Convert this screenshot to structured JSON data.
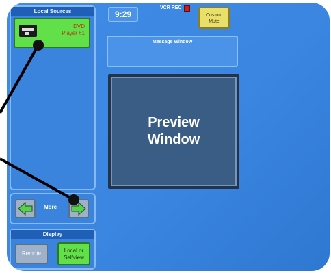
{
  "local_sources": {
    "title": "Local Sources",
    "item_label": "DVD Player #1"
  },
  "header": {
    "time": "9:29",
    "vcr_label": "VCR REC",
    "custom_mute_label": "Custom Mute"
  },
  "message_window": {
    "title": "Message Window"
  },
  "preview": {
    "label": "Preview Window"
  },
  "nav": {
    "more_label": "More"
  },
  "display": {
    "title": "Display",
    "remote_label": "Remote",
    "local_label": "Local or Selfview"
  },
  "colors": {
    "screen": "#3a86e0",
    "green_button": "#62e049",
    "preview": "#3a5d86"
  }
}
